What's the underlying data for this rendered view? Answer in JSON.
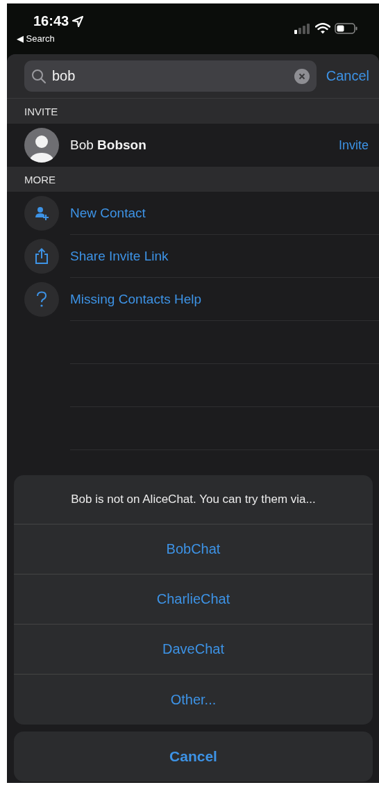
{
  "status_bar": {
    "time": "16:43",
    "back_label": "◀ Search"
  },
  "search": {
    "value": "bob",
    "cancel": "Cancel"
  },
  "sections": [
    {
      "title": "INVITE",
      "rows": [
        {
          "kind": "contact",
          "name": "Bob **Bobson**",
          "action": "Invite"
        }
      ]
    },
    {
      "title": "MORE",
      "rows": [
        {
          "kind": "new-contact",
          "name": "New Contact"
        },
        {
          "kind": "share",
          "name": "Share Invite Link"
        },
        {
          "kind": "help",
          "name": "Missing Contacts Help"
        }
      ]
    }
  ],
  "action_sheet": {
    "message": "Bob is not on AliceChat. You can try them via...",
    "options": [
      "BobChat",
      "CharlieChat",
      "DaveChat",
      "Other..."
    ],
    "cancel": "Cancel"
  }
}
